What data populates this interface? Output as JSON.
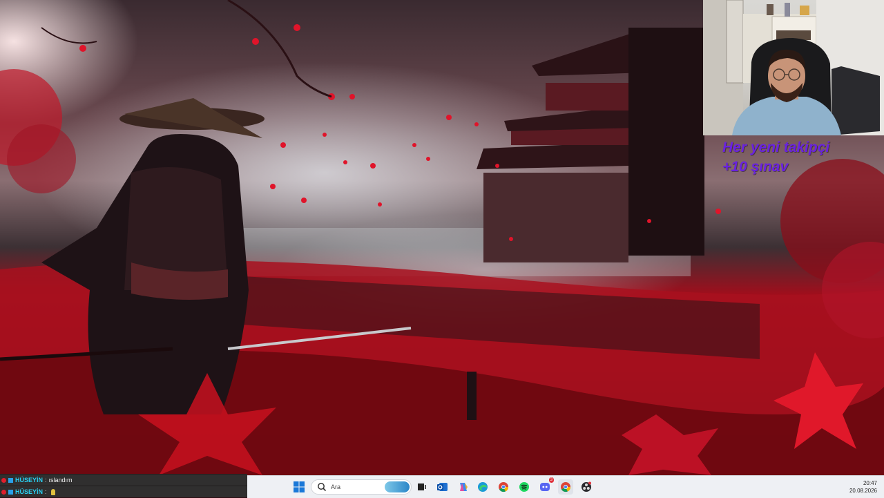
{
  "overlay": {
    "line1": "Her yeni takipçi",
    "line2": "+10 şınav"
  },
  "chat": {
    "messages": [
      {
        "user": "HÜSEYİN",
        "separator": ":",
        "text": "ıslandım"
      },
      {
        "user": "HÜSEYİN",
        "separator": ":",
        "text": ""
      }
    ]
  },
  "taskbar": {
    "search_placeholder": "Ara",
    "icons": [
      "windows-start-icon",
      "search-icon",
      "task-view-icon",
      "outlook-icon",
      "copilot-icon",
      "edge-icon",
      "chrome-icon",
      "spotify-icon",
      "discord-icon",
      "chrome-icon",
      "obs-icon"
    ],
    "discord_badge": "3",
    "time": "20:47",
    "date": "20.08.2026"
  },
  "colors": {
    "overlay_text": "#6a22e0",
    "chat_username": "#2ad0f2",
    "taskbar_bg": "#eef0f4"
  }
}
